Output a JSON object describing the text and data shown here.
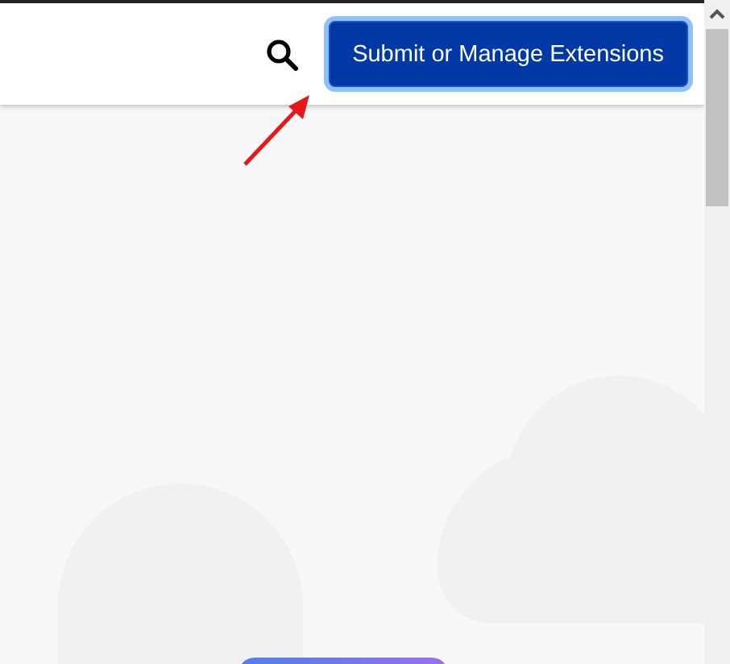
{
  "header": {
    "submit_button": {
      "label": "Submit or Manage Extensions",
      "focused": true
    }
  }
}
